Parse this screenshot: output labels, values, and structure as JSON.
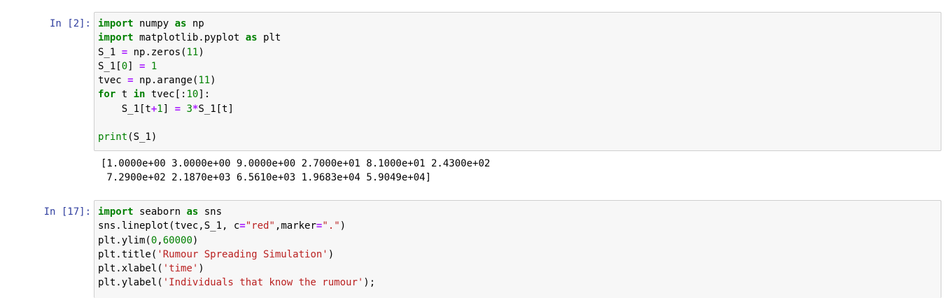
{
  "cells": [
    {
      "prompt": "In [2]:",
      "lines": [
        [
          {
            "t": "import",
            "c": "kw"
          },
          {
            "t": " numpy ",
            "c": ""
          },
          {
            "t": "as",
            "c": "kw"
          },
          {
            "t": " np",
            "c": ""
          }
        ],
        [
          {
            "t": "import",
            "c": "kw"
          },
          {
            "t": " matplotlib.pyplot ",
            "c": ""
          },
          {
            "t": "as",
            "c": "kw"
          },
          {
            "t": " plt",
            "c": ""
          }
        ],
        [
          {
            "t": "S_1 ",
            "c": ""
          },
          {
            "t": "=",
            "c": "op"
          },
          {
            "t": " np.zeros(",
            "c": ""
          },
          {
            "t": "11",
            "c": "num"
          },
          {
            "t": ")",
            "c": ""
          }
        ],
        [
          {
            "t": "S_1[",
            "c": ""
          },
          {
            "t": "0",
            "c": "num"
          },
          {
            "t": "] ",
            "c": ""
          },
          {
            "t": "=",
            "c": "op"
          },
          {
            "t": " ",
            "c": ""
          },
          {
            "t": "1",
            "c": "num"
          }
        ],
        [
          {
            "t": "tvec ",
            "c": ""
          },
          {
            "t": "=",
            "c": "op"
          },
          {
            "t": " np.arange(",
            "c": ""
          },
          {
            "t": "11",
            "c": "num"
          },
          {
            "t": ")",
            "c": ""
          }
        ],
        [
          {
            "t": "for",
            "c": "kw"
          },
          {
            "t": " t ",
            "c": ""
          },
          {
            "t": "in",
            "c": "kw"
          },
          {
            "t": " tvec[:",
            "c": ""
          },
          {
            "t": "10",
            "c": "num"
          },
          {
            "t": "]:",
            "c": ""
          }
        ],
        [
          {
            "t": "    S_1[t",
            "c": ""
          },
          {
            "t": "+",
            "c": "op"
          },
          {
            "t": "1",
            "c": "num"
          },
          {
            "t": "] ",
            "c": ""
          },
          {
            "t": "=",
            "c": "op"
          },
          {
            "t": " ",
            "c": ""
          },
          {
            "t": "3",
            "c": "num"
          },
          {
            "t": "*",
            "c": "op"
          },
          {
            "t": "S_1[t]",
            "c": ""
          }
        ],
        [],
        [
          {
            "t": "print",
            "c": "bi"
          },
          {
            "t": "(S_1)",
            "c": ""
          }
        ]
      ],
      "output": "[1.0000e+00 3.0000e+00 9.0000e+00 2.7000e+01 8.1000e+01 2.4300e+02\n 7.2900e+02 2.1870e+03 6.5610e+03 1.9683e+04 5.9049e+04]"
    },
    {
      "prompt": "In [17]:",
      "lines": [
        [
          {
            "t": "import",
            "c": "kw"
          },
          {
            "t": " seaborn ",
            "c": ""
          },
          {
            "t": "as",
            "c": "kw"
          },
          {
            "t": " sns",
            "c": ""
          }
        ],
        [
          {
            "t": "sns.lineplot(tvec,S_1, c",
            "c": ""
          },
          {
            "t": "=",
            "c": "op"
          },
          {
            "t": "\"red\"",
            "c": "str"
          },
          {
            "t": ",marker",
            "c": ""
          },
          {
            "t": "=",
            "c": "op"
          },
          {
            "t": "\".\"",
            "c": "str"
          },
          {
            "t": ")",
            "c": ""
          }
        ],
        [
          {
            "t": "plt.ylim(",
            "c": ""
          },
          {
            "t": "0",
            "c": "num"
          },
          {
            "t": ",",
            "c": ""
          },
          {
            "t": "60000",
            "c": "num"
          },
          {
            "t": ")",
            "c": ""
          }
        ],
        [
          {
            "t": "plt.title(",
            "c": ""
          },
          {
            "t": "'Rumour Spreading Simulation'",
            "c": "str"
          },
          {
            "t": ")",
            "c": ""
          }
        ],
        [
          {
            "t": "plt.xlabel(",
            "c": ""
          },
          {
            "t": "'time'",
            "c": "str"
          },
          {
            "t": ")",
            "c": ""
          }
        ],
        [
          {
            "t": "plt.ylabel(",
            "c": ""
          },
          {
            "t": "'Individuals that know the rumour'",
            "c": "str"
          },
          {
            "t": ");",
            "c": ""
          }
        ]
      ]
    }
  ]
}
